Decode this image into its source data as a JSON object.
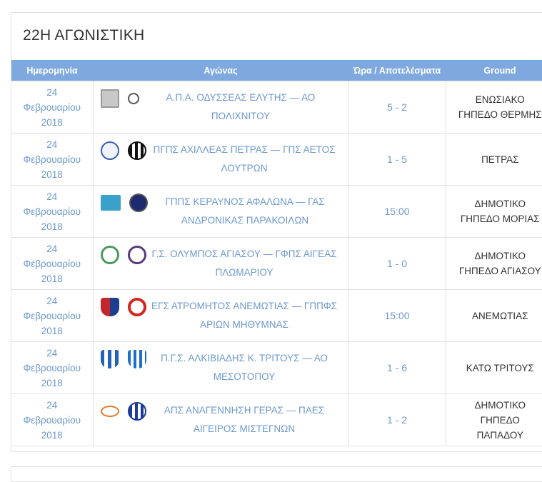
{
  "round": {
    "title": "22Η ΑΓΩΝΙΣΤΙΚΗ"
  },
  "table": {
    "headers": [
      "Ημερομηνία",
      "Αγώνας",
      "Ώρα / Αποτελέσματα",
      "Ground"
    ],
    "rows": [
      {
        "date": [
          "24",
          "Φεβρουαρίου",
          "2018"
        ],
        "match": "Α.Π.Α. ΟΔΥΣΣΕΑΣ ΕΛΥΤΗΣ — ΑΟ ΠΟΛΙΧΝΙΤΟΥ",
        "match_lines": [
          "Α.Π.Α. ΟΔΥΣΣΕΑΣ ΕΛΥΤΗΣ — ΑΟ",
          "ΠΟΛΙΧΝΙΤΟΥ"
        ],
        "score": "5 - 2",
        "ground": [
          "ΕΝΩΣΙΑΚΟ",
          "ΓΗΠΕΔΟ ΘΕΡΜΗΣ"
        ],
        "home_logo": "grey-crest-logo",
        "away_logo": "small-crest-logo"
      },
      {
        "date": [
          "24",
          "Φεβρουαρίου",
          "2018"
        ],
        "match": "ΠΓΠΣ ΑΧΙΛΛΕΑΣ ΠΕΤΡΑΣ — ΓΠΣ ΑΕΤΟΣ ΛΟΥΤΡΩΝ",
        "match_lines": [
          "ΠΓΠΣ ΑΧΙΛΛΕΑΣ ΠΕΤΡΑΣ — ΓΠΣ ΑΕΤΟΣ",
          "ΛΟΥΤΡΩΝ"
        ],
        "score": "1 - 5",
        "ground": [
          "ΠΕΤΡΑΣ"
        ],
        "home_logo": "blue-circle-logo",
        "away_logo": "black-white-stripes-logo"
      },
      {
        "date": [
          "24",
          "Φεβρουαρίου",
          "2018"
        ],
        "match": "ΓΠΠΣ ΚΕΡΑΥΝΟΣ ΑΦΑΛΩΝΑ — ΓΑΣ ΑΝΔΡΟΝΙΚΑΣ ΠΑΡΑΚΟΙΛΩΝ",
        "match_lines": [
          "ΓΠΠΣ ΚΕΡΑΥΝΟΣ ΑΦΑΛΩΝΑ — ΓΑΣ",
          "ΑΝΔΡΟΝΙΚΑΣ ΠΑΡΑΚΟΙΛΩΝ"
        ],
        "score": "15:00",
        "ground": [
          "ΔΗΜΟΤΙΚΟ",
          "ΓΗΠΕΔΟ ΜΟΡΙΑΣ"
        ],
        "home_logo": "teal-square-logo",
        "away_logo": "navy-circle-logo"
      },
      {
        "date": [
          "24",
          "Φεβρουαρίου",
          "2018"
        ],
        "match": "Γ.Σ. ΟΛΥΜΠΟΣ ΑΓΙΑΣΟΥ — ΓΦΠΣ ΑΙΓΕΑΣ ΠΛΩΜΑΡΙΟΥ",
        "match_lines": [
          "Γ.Σ. ΟΛΥΜΠΟΣ ΑΓΙΑΣΟΥ — ΓΦΠΣ ΑΙΓΕΑΣ",
          "ΠΛΩΜΑΡΙΟΥ"
        ],
        "score": "1 - 0",
        "ground": [
          "ΔΗΜΟΤΙΚΟ",
          "ΓΗΠΕΔΟ ΑΓΙΑΣΟΥ"
        ],
        "home_logo": "green-white-logo",
        "away_logo": "purple-figure-logo"
      },
      {
        "date": [
          "24",
          "Φεβρουαρίου",
          "2018"
        ],
        "match": "ΕΓΣ ΑΤΡΟΜΗΤΟΣ ΑΝΕΜΩΤΙΑΣ — ΓΠΠΦΣ ΑΡΙΩΝ ΜΗΘΥΜΝΑΣ",
        "match_lines": [
          "ΕΓΣ ΑΤΡΟΜΗΤΟΣ ΑΝΕΜΩΤΙΑΣ — ΓΠΠΦΣ",
          "ΑΡΙΩΝ ΜΗΘΥΜΝΑΣ"
        ],
        "score": "15:00",
        "ground": [
          "ΑΝΕΜΩΤΙΑΣ"
        ],
        "home_logo": "red-blue-shield-logo",
        "away_logo": "red-ring-logo"
      },
      {
        "date": [
          "24",
          "Φεβρουαρίου",
          "2018"
        ],
        "match": "Π.Γ.Σ. ΑΛΚΙΒΙΑΔΗΣ Κ. ΤΡΙΤΟΥΣ — ΑΟ ΜΕΣΟΤΟΠΟΥ",
        "match_lines": [
          "Π.Γ.Σ. ΑΛΚΙΒΙΑΔΗΣ Κ. ΤΡΙΤΟΥΣ — ΑΟ",
          "ΜΕΣΟΤΟΠΟΥ"
        ],
        "score": "1 - 6",
        "ground": [
          "ΚΑΤΩ ΤΡΙΤΟΥΣ"
        ],
        "home_logo": "blue-white-shield-logo",
        "away_logo": "blue-stripes-shield-logo"
      },
      {
        "date": [
          "24",
          "Φεβρουαρίου",
          "2018"
        ],
        "match": "ΑΠΣ ΑΝΑΓΕΝΝΗΣΗ ΓΕΡΑΣ — ΠΑΕΣ ΑΙΓΕΙΡΟΣ ΜΙΣΤΕΓΝΩΝ",
        "match_lines": [
          "ΑΠΣ ΑΝΑΓΕΝΝΗΣΗ ΓΕΡΑΣ — ΠΑΕΣ",
          "ΑΙΓΕΙΡΟΣ ΜΙΣΤΕΓΝΩΝ"
        ],
        "score": "1 - 2",
        "ground": [
          "ΔΗΜΟΤΙΚΟ",
          "ΓΗΠΕΔΟ",
          "ΠΑΠΑΔΟΥ"
        ],
        "home_logo": "orange-ball-logo",
        "away_logo": "blue-white-stripes-logo"
      }
    ]
  },
  "colors": {
    "header_bg": "#7fa9de",
    "link_text": "#6b98cf",
    "border": "#e2e2e2"
  }
}
